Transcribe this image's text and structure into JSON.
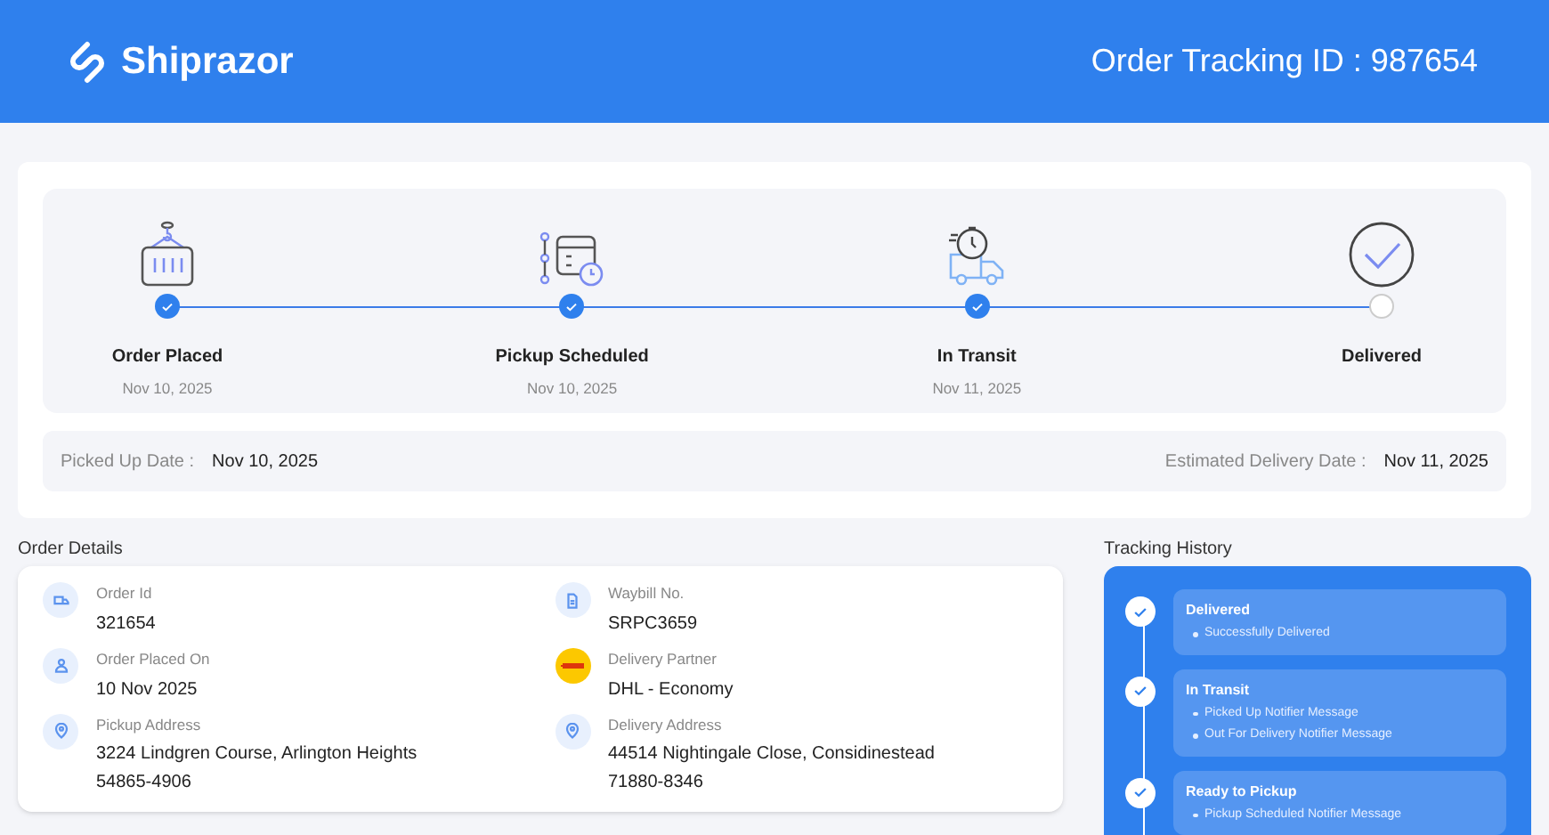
{
  "header": {
    "brand": "Shiprazor",
    "tracking_id": "Order Tracking ID : 987654"
  },
  "progress": {
    "steps": [
      {
        "kind": "crate",
        "label": "Order Placed",
        "date": "Nov 10, 2025",
        "done": true
      },
      {
        "kind": "schedule",
        "label": "Pickup Scheduled",
        "date": "Nov 10, 2025",
        "done": true
      },
      {
        "kind": "truck",
        "label": "In Transit",
        "date": "Nov 11, 2025",
        "done": true
      },
      {
        "kind": "check",
        "label": "Delivered",
        "done": false
      }
    ],
    "picked_up": {
      "label": "Picked Up Date :",
      "value": "Nov 10, 2025"
    },
    "estimated": {
      "label": "Estimated Delivery Date :",
      "value": "Nov 11, 2025"
    }
  },
  "order_details": {
    "title": "Order Details",
    "fields": [
      {
        "kind": "truck",
        "label": "Order Id",
        "value": "321654"
      },
      {
        "kind": "document",
        "label": "Waybill No.",
        "value": "SRPC3659"
      },
      {
        "kind": "person",
        "label": "Order Placed On",
        "value": "10 Nov 2025"
      },
      {
        "kind": "carrier",
        "label": "Delivery Partner",
        "value": "DHL - Economy"
      },
      {
        "kind": "pin",
        "label": "Pickup Address",
        "value": [
          "3224 Lindgren Course, Arlington Heights",
          "54865-4906"
        ]
      },
      {
        "kind": "pin",
        "label": "Delivery Address",
        "value": [
          "44514 Nightingale Close, Considinestead",
          "71880-8346"
        ]
      }
    ]
  },
  "tracking_history": {
    "title": "Tracking History",
    "events": [
      {
        "status": "Delivered",
        "messages": [
          "Successfully Delivered"
        ]
      },
      {
        "status": "In Transit",
        "messages": [
          "Picked Up Notifier Message",
          "Out For Delivery Notifier Message"
        ]
      },
      {
        "status": "Ready to Pickup",
        "messages": [
          "Pickup Scheduled Notifier Message"
        ]
      }
    ]
  }
}
